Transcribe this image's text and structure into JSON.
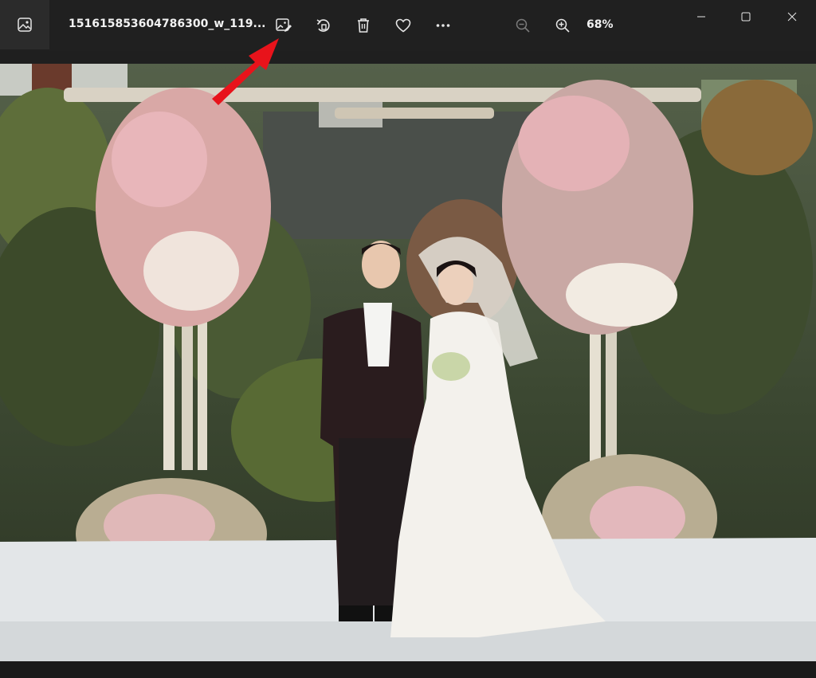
{
  "titlebar": {
    "filename": "151615853604786300_w_119...",
    "zoom": "68%"
  },
  "toolbar": {
    "icons": [
      "edit-image-icon",
      "rotate-icon",
      "delete-icon",
      "favorite-icon",
      "more-icon",
      "zoom-out-icon",
      "zoom-in-icon"
    ]
  },
  "window_controls": [
    "minimize-icon",
    "maximize-icon",
    "close-icon"
  ],
  "colors": {
    "titlebar_bg": "#202020",
    "text": "#f2f2f2",
    "annotation_arrow": "#e8131b"
  }
}
